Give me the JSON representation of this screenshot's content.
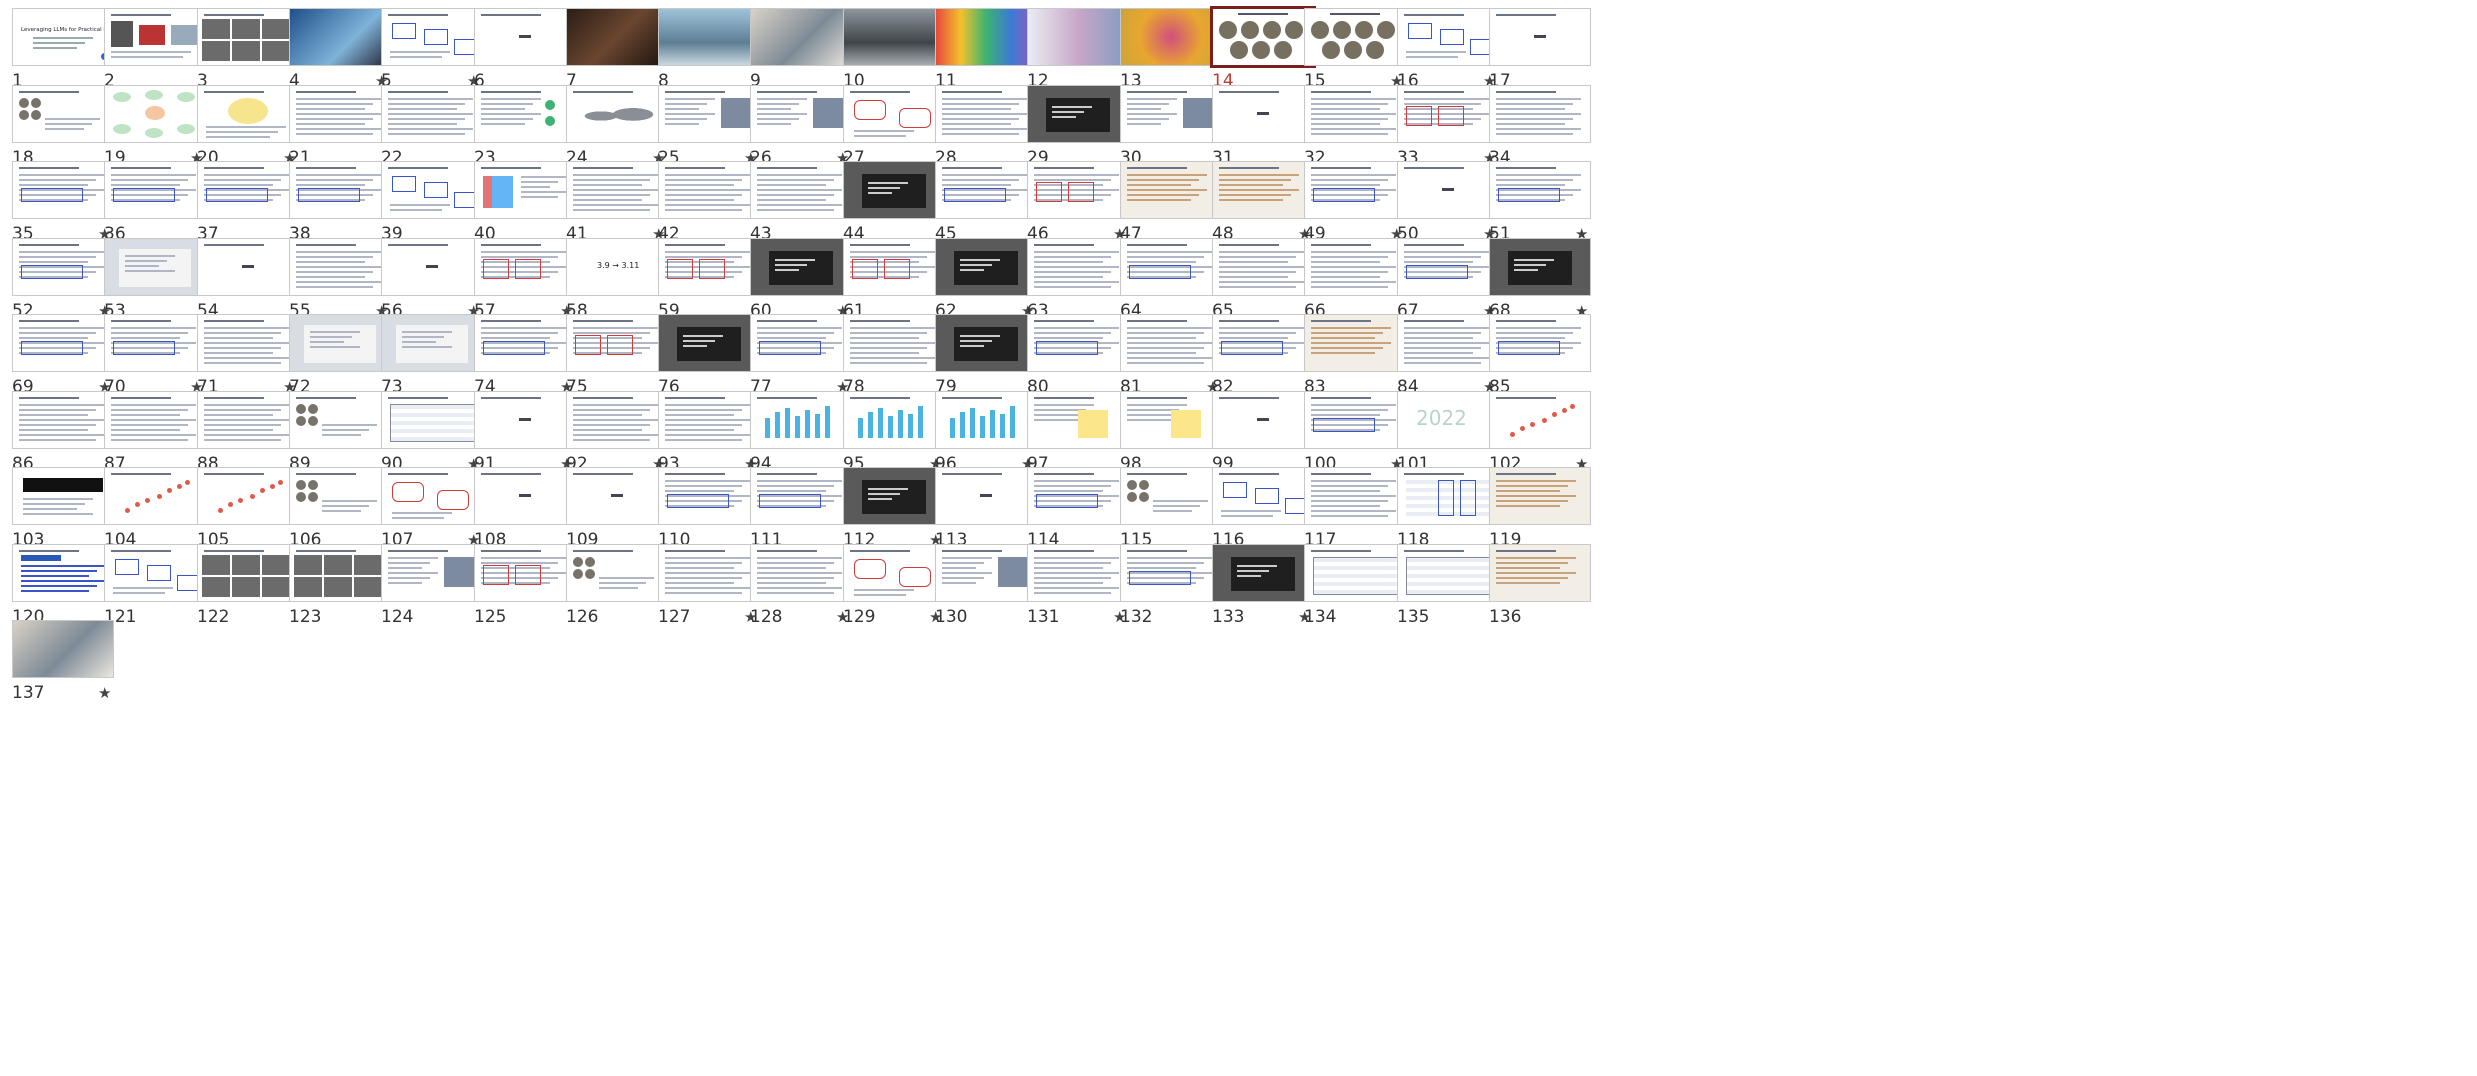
{
  "view": "slide-sorter",
  "selected_slide": 14,
  "slides": [
    {
      "n": "1",
      "star": false,
      "kind": "title",
      "caption": "Leveraging LLMs for Practical Research Applications"
    },
    {
      "n": "2",
      "star": false,
      "kind": "bio"
    },
    {
      "n": "3",
      "star": false,
      "kind": "photos-grid"
    },
    {
      "n": "4",
      "star": true,
      "kind": "photo-blue"
    },
    {
      "n": "5",
      "star": true,
      "kind": "diagram"
    },
    {
      "n": "6",
      "star": false,
      "kind": "text-center"
    },
    {
      "n": "7",
      "star": false,
      "kind": "photo-dark"
    },
    {
      "n": "8",
      "star": false,
      "kind": "photo-lab"
    },
    {
      "n": "9",
      "star": false,
      "kind": "photo-office"
    },
    {
      "n": "10",
      "star": false,
      "kind": "photo-gray"
    },
    {
      "n": "11",
      "star": false,
      "kind": "photo-colorful"
    },
    {
      "n": "12",
      "star": false,
      "kind": "photo-light"
    },
    {
      "n": "13",
      "star": false,
      "kind": "photo-gold"
    },
    {
      "n": "14",
      "star": false,
      "kind": "circles"
    },
    {
      "n": "15",
      "star": true,
      "kind": "circles"
    },
    {
      "n": "16",
      "star": true,
      "kind": "diagram"
    },
    {
      "n": "17",
      "star": false,
      "kind": "text-center"
    },
    {
      "n": "18",
      "star": false,
      "kind": "circles-small"
    },
    {
      "n": "19",
      "star": true,
      "kind": "mindmap"
    },
    {
      "n": "20",
      "star": true,
      "kind": "diagram-yellow"
    },
    {
      "n": "21",
      "star": false,
      "kind": "text"
    },
    {
      "n": "22",
      "star": false,
      "kind": "text"
    },
    {
      "n": "23",
      "star": false,
      "kind": "text-green"
    },
    {
      "n": "24",
      "star": true,
      "kind": "map"
    },
    {
      "n": "25",
      "star": true,
      "kind": "text-photo"
    },
    {
      "n": "26",
      "star": true,
      "kind": "text-photo"
    },
    {
      "n": "27",
      "star": false,
      "kind": "diagram-red"
    },
    {
      "n": "28",
      "star": false,
      "kind": "text"
    },
    {
      "n": "29",
      "star": false,
      "kind": "dark-panel"
    },
    {
      "n": "30",
      "star": false,
      "kind": "text-photo"
    },
    {
      "n": "31",
      "star": false,
      "kind": "text-center"
    },
    {
      "n": "32",
      "star": false,
      "kind": "text"
    },
    {
      "n": "33",
      "star": true,
      "kind": "text-red"
    },
    {
      "n": "34",
      "star": false,
      "kind": "text"
    },
    {
      "n": "35",
      "star": true,
      "kind": "text-blue"
    },
    {
      "n": "36",
      "star": false,
      "kind": "text-blue"
    },
    {
      "n": "37",
      "star": false,
      "kind": "text-blue"
    },
    {
      "n": "38",
      "star": false,
      "kind": "text-blue"
    },
    {
      "n": "39",
      "star": false,
      "kind": "diagram"
    },
    {
      "n": "40",
      "star": false,
      "kind": "chart"
    },
    {
      "n": "41",
      "star": true,
      "kind": "text"
    },
    {
      "n": "42",
      "star": false,
      "kind": "text"
    },
    {
      "n": "43",
      "star": false,
      "kind": "text"
    },
    {
      "n": "44",
      "star": false,
      "kind": "dark-panel"
    },
    {
      "n": "45",
      "star": false,
      "kind": "text-blue"
    },
    {
      "n": "46",
      "star": true,
      "kind": "text-red"
    },
    {
      "n": "47",
      "star": false,
      "kind": "beige"
    },
    {
      "n": "48",
      "star": true,
      "kind": "beige"
    },
    {
      "n": "49",
      "star": true,
      "kind": "text-blue"
    },
    {
      "n": "50",
      "star": true,
      "kind": "text-center"
    },
    {
      "n": "51",
      "star": true,
      "kind": "text-blue"
    },
    {
      "n": "52",
      "star": true,
      "kind": "text-blue"
    },
    {
      "n": "53",
      "star": false,
      "kind": "gray-panel"
    },
    {
      "n": "54",
      "star": false,
      "kind": "text-center"
    },
    {
      "n": "55",
      "star": true,
      "kind": "text"
    },
    {
      "n": "56",
      "star": true,
      "kind": "text-center"
    },
    {
      "n": "57",
      "star": true,
      "kind": "text-red"
    },
    {
      "n": "58",
      "star": false,
      "kind": "equation",
      "caption": "3.9 → 3.11"
    },
    {
      "n": "59",
      "star": false,
      "kind": "text-red"
    },
    {
      "n": "60",
      "star": true,
      "kind": "dark-panel"
    },
    {
      "n": "61",
      "star": false,
      "kind": "text-red"
    },
    {
      "n": "62",
      "star": true,
      "kind": "dark-panel"
    },
    {
      "n": "63",
      "star": false,
      "kind": "text"
    },
    {
      "n": "64",
      "star": false,
      "kind": "text-blue"
    },
    {
      "n": "65",
      "star": false,
      "kind": "text"
    },
    {
      "n": "66",
      "star": false,
      "kind": "text"
    },
    {
      "n": "67",
      "star": true,
      "kind": "text-blue"
    },
    {
      "n": "68",
      "star": true,
      "kind": "dark-panel"
    },
    {
      "n": "69",
      "star": true,
      "kind": "text-blue"
    },
    {
      "n": "70",
      "star": true,
      "kind": "text-blue"
    },
    {
      "n": "71",
      "star": true,
      "kind": "text"
    },
    {
      "n": "72",
      "star": false,
      "kind": "gray-panel"
    },
    {
      "n": "73",
      "star": false,
      "kind": "gray-panel"
    },
    {
      "n": "74",
      "star": true,
      "kind": "text-blue"
    },
    {
      "n": "75",
      "star": false,
      "kind": "text-red"
    },
    {
      "n": "76",
      "star": false,
      "kind": "dark-panel"
    },
    {
      "n": "77",
      "star": true,
      "kind": "text-blue"
    },
    {
      "n": "78",
      "star": false,
      "kind": "text"
    },
    {
      "n": "79",
      "star": false,
      "kind": "dark-panel"
    },
    {
      "n": "80",
      "star": false,
      "kind": "text-blue"
    },
    {
      "n": "81",
      "star": true,
      "kind": "text"
    },
    {
      "n": "82",
      "star": false,
      "kind": "text-blue"
    },
    {
      "n": "83",
      "star": false,
      "kind": "beige"
    },
    {
      "n": "84",
      "star": true,
      "kind": "text"
    },
    {
      "n": "85",
      "star": false,
      "kind": "text-blue"
    },
    {
      "n": "86",
      "star": false,
      "kind": "text"
    },
    {
      "n": "87",
      "star": false,
      "kind": "text"
    },
    {
      "n": "88",
      "star": false,
      "kind": "text"
    },
    {
      "n": "89",
      "star": false,
      "kind": "circles-small"
    },
    {
      "n": "90",
      "star": true,
      "kind": "table"
    },
    {
      "n": "91",
      "star": true,
      "kind": "text-center"
    },
    {
      "n": "92",
      "star": true,
      "kind": "text"
    },
    {
      "n": "93",
      "star": true,
      "kind": "text"
    },
    {
      "n": "94",
      "star": false,
      "kind": "bars"
    },
    {
      "n": "95",
      "star": true,
      "kind": "bars"
    },
    {
      "n": "96",
      "star": true,
      "kind": "bars"
    },
    {
      "n": "97",
      "star": false,
      "kind": "yellow"
    },
    {
      "n": "98",
      "star": false,
      "kind": "yellow"
    },
    {
      "n": "99",
      "star": false,
      "kind": "text-center"
    },
    {
      "n": "100",
      "star": true,
      "kind": "text-blue"
    },
    {
      "n": "101",
      "star": false,
      "kind": "year",
      "caption": "2022"
    },
    {
      "n": "102",
      "star": true,
      "kind": "scatter"
    },
    {
      "n": "103",
      "star": false,
      "kind": "black-bar"
    },
    {
      "n": "104",
      "star": false,
      "kind": "scatter"
    },
    {
      "n": "105",
      "star": false,
      "kind": "scatter"
    },
    {
      "n": "106",
      "star": false,
      "kind": "circles-small"
    },
    {
      "n": "107",
      "star": true,
      "kind": "diagram-red"
    },
    {
      "n": "108",
      "star": false,
      "kind": "text-center"
    },
    {
      "n": "109",
      "star": false,
      "kind": "text-center"
    },
    {
      "n": "110",
      "star": false,
      "kind": "text-blue"
    },
    {
      "n": "111",
      "star": false,
      "kind": "text-blue"
    },
    {
      "n": "112",
      "star": true,
      "kind": "dark-panel"
    },
    {
      "n": "113",
      "star": false,
      "kind": "text-center"
    },
    {
      "n": "114",
      "star": false,
      "kind": "text-blue"
    },
    {
      "n": "115",
      "star": false,
      "kind": "circles-small"
    },
    {
      "n": "116",
      "star": false,
      "kind": "diagram"
    },
    {
      "n": "117",
      "star": false,
      "kind": "text"
    },
    {
      "n": "118",
      "star": false,
      "kind": "table-blue"
    },
    {
      "n": "119",
      "star": false,
      "kind": "beige"
    },
    {
      "n": "120",
      "star": false,
      "kind": "paper"
    },
    {
      "n": "121",
      "star": false,
      "kind": "diagram"
    },
    {
      "n": "122",
      "star": false,
      "kind": "photos-grid"
    },
    {
      "n": "123",
      "star": false,
      "kind": "photos-grid"
    },
    {
      "n": "124",
      "star": false,
      "kind": "text-photo"
    },
    {
      "n": "125",
      "star": false,
      "kind": "text-red"
    },
    {
      "n": "126",
      "star": false,
      "kind": "circles-small"
    },
    {
      "n": "127",
      "star": true,
      "kind": "text"
    },
    {
      "n": "128",
      "star": true,
      "kind": "text"
    },
    {
      "n": "129",
      "star": true,
      "kind": "diagram-red"
    },
    {
      "n": "130",
      "star": false,
      "kind": "text-photo"
    },
    {
      "n": "131",
      "star": true,
      "kind": "text"
    },
    {
      "n": "132",
      "star": false,
      "kind": "text-blue"
    },
    {
      "n": "133",
      "star": true,
      "kind": "dark-panel"
    },
    {
      "n": "134",
      "star": false,
      "kind": "table"
    },
    {
      "n": "135",
      "star": false,
      "kind": "table"
    },
    {
      "n": "136",
      "star": false,
      "kind": "beige"
    },
    {
      "n": "137",
      "star": true,
      "kind": "photo-office"
    }
  ],
  "colors": {
    "selected_border": "#7a1e1e",
    "selected_number": "#c0392b"
  }
}
